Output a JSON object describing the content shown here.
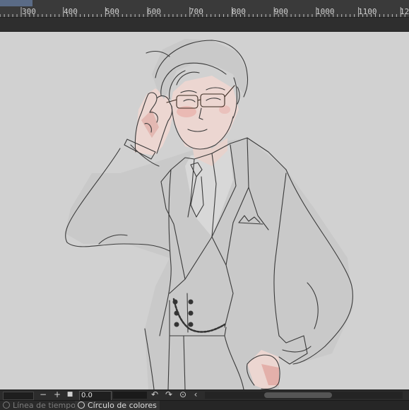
{
  "ruler": {
    "labels": [
      "300",
      "400",
      "500",
      "600",
      "700",
      "800",
      "900",
      "1000",
      "1100",
      "12"
    ],
    "tab_color": "#5a6b86"
  },
  "canvas": {
    "background": "#d1d1d1",
    "artwork": "drawing-of-man-in-suit-adjusting-glasses"
  },
  "timeline_controls": {
    "minus_label": "−",
    "plus_label": "+",
    "stop_label": "■",
    "value": "0.0",
    "undo_icon": "rotate-left-icon",
    "redo_icon": "rotate-right-icon",
    "reset_icon": "reset-rotation-icon",
    "prev_icon": "chevron-left-icon"
  },
  "panel_tabs": [
    {
      "label": "Línea de tiempo",
      "active": false
    },
    {
      "label": "Círculo de colores",
      "active": true
    }
  ]
}
